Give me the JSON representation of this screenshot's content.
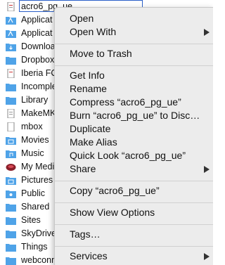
{
  "finder": {
    "items": [
      {
        "name": "acro6_pg_ue",
        "icon": "document-icon",
        "selected": true
      },
      {
        "name": "Applicat",
        "icon": "applications-folder-icon"
      },
      {
        "name": "Applicat",
        "icon": "applications-folder-icon"
      },
      {
        "name": "Downloa",
        "icon": "downloads-folder-icon"
      },
      {
        "name": "Dropbox",
        "icon": "folder-icon"
      },
      {
        "name": "Iberia FC",
        "icon": "document-icon"
      },
      {
        "name": "Incomple",
        "icon": "folder-icon"
      },
      {
        "name": "Library",
        "icon": "folder-icon"
      },
      {
        "name": "MakeMK",
        "icon": "document-icon"
      },
      {
        "name": "mbox",
        "icon": "document-icon"
      },
      {
        "name": "Movies",
        "icon": "movies-folder-icon"
      },
      {
        "name": "Music",
        "icon": "music-folder-icon"
      },
      {
        "name": "My Medi",
        "icon": "media-icon"
      },
      {
        "name": "Pictures",
        "icon": "pictures-folder-icon"
      },
      {
        "name": "Public",
        "icon": "public-folder-icon"
      },
      {
        "name": "Shared",
        "icon": "folder-icon"
      },
      {
        "name": "Sites",
        "icon": "folder-icon"
      },
      {
        "name": "SkyDrive",
        "icon": "folder-icon"
      },
      {
        "name": "Things",
        "icon": "folder-icon"
      },
      {
        "name": "webconn",
        "icon": "folder-icon"
      }
    ]
  },
  "menu": {
    "open": "Open",
    "open_with": "Open With",
    "move_to_trash": "Move to Trash",
    "get_info": "Get Info",
    "rename": "Rename",
    "compress": "Compress “acro6_pg_ue”",
    "burn": "Burn “acro6_pg_ue” to Disc…",
    "duplicate": "Duplicate",
    "make_alias": "Make Alias",
    "quick_look": "Quick Look “acro6_pg_ue”",
    "share": "Share",
    "copy": "Copy “acro6_pg_ue”",
    "show_view_options": "Show View Options",
    "tags": "Tags…",
    "services": "Services"
  },
  "colors": {
    "menu_bg": "#ececec",
    "folder_blue": "#4fa3e8",
    "selection_outline": "#2a5fc8"
  }
}
